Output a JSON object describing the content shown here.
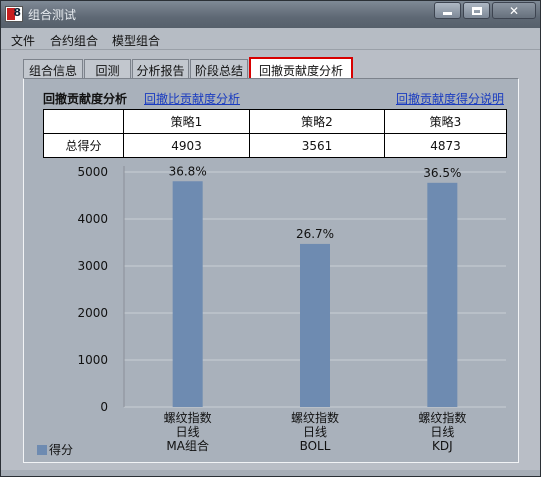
{
  "window": {
    "title": "组合测试"
  },
  "menu": [
    "文件",
    "合约组合",
    "模型组合"
  ],
  "tabs": [
    "组合信息",
    "回测",
    "分析报告",
    "阶段总结",
    "回撤贡献度分析"
  ],
  "active_tab_index": 4,
  "section": {
    "title": "回撤贡献度分析",
    "link1": "回撤比贡献度分析",
    "link2": "回撤贡献度得分说明"
  },
  "table": {
    "headers": [
      "",
      "策略1",
      "策略2",
      "策略3"
    ],
    "row": [
      "总得分",
      "4903",
      "3561",
      "4873"
    ]
  },
  "chart_data": {
    "type": "bar",
    "categories": [
      [
        "螺纹指数",
        "日线",
        "MA组合"
      ],
      [
        "螺纹指数",
        "日线",
        "BOLL"
      ],
      [
        "螺纹指数",
        "日线",
        "KDJ"
      ]
    ],
    "series": [
      {
        "name": "得分",
        "values": [
          4803,
          3470,
          4770
        ]
      }
    ],
    "data_labels": [
      "36.8%",
      "26.7%",
      "36.5%"
    ],
    "ylim": [
      0,
      5000
    ],
    "yticks": [
      0,
      1000,
      2000,
      3000,
      4000,
      5000
    ],
    "grid": true,
    "legend": "bottom-left",
    "bar_color": "#6e8bb1"
  }
}
